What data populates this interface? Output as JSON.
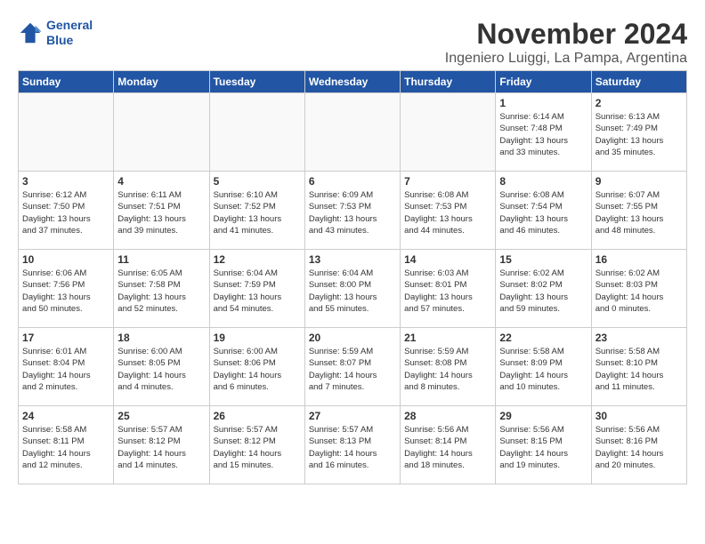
{
  "logo": {
    "line1": "General",
    "line2": "Blue"
  },
  "title": "November 2024",
  "subtitle": "Ingeniero Luiggi, La Pampa, Argentina",
  "headers": [
    "Sunday",
    "Monday",
    "Tuesday",
    "Wednesday",
    "Thursday",
    "Friday",
    "Saturday"
  ],
  "rows": [
    [
      {
        "day": "",
        "text": ""
      },
      {
        "day": "",
        "text": ""
      },
      {
        "day": "",
        "text": ""
      },
      {
        "day": "",
        "text": ""
      },
      {
        "day": "",
        "text": ""
      },
      {
        "day": "1",
        "text": "Sunrise: 6:14 AM\nSunset: 7:48 PM\nDaylight: 13 hours\nand 33 minutes."
      },
      {
        "day": "2",
        "text": "Sunrise: 6:13 AM\nSunset: 7:49 PM\nDaylight: 13 hours\nand 35 minutes."
      }
    ],
    [
      {
        "day": "3",
        "text": "Sunrise: 6:12 AM\nSunset: 7:50 PM\nDaylight: 13 hours\nand 37 minutes."
      },
      {
        "day": "4",
        "text": "Sunrise: 6:11 AM\nSunset: 7:51 PM\nDaylight: 13 hours\nand 39 minutes."
      },
      {
        "day": "5",
        "text": "Sunrise: 6:10 AM\nSunset: 7:52 PM\nDaylight: 13 hours\nand 41 minutes."
      },
      {
        "day": "6",
        "text": "Sunrise: 6:09 AM\nSunset: 7:53 PM\nDaylight: 13 hours\nand 43 minutes."
      },
      {
        "day": "7",
        "text": "Sunrise: 6:08 AM\nSunset: 7:53 PM\nDaylight: 13 hours\nand 44 minutes."
      },
      {
        "day": "8",
        "text": "Sunrise: 6:08 AM\nSunset: 7:54 PM\nDaylight: 13 hours\nand 46 minutes."
      },
      {
        "day": "9",
        "text": "Sunrise: 6:07 AM\nSunset: 7:55 PM\nDaylight: 13 hours\nand 48 minutes."
      }
    ],
    [
      {
        "day": "10",
        "text": "Sunrise: 6:06 AM\nSunset: 7:56 PM\nDaylight: 13 hours\nand 50 minutes."
      },
      {
        "day": "11",
        "text": "Sunrise: 6:05 AM\nSunset: 7:58 PM\nDaylight: 13 hours\nand 52 minutes."
      },
      {
        "day": "12",
        "text": "Sunrise: 6:04 AM\nSunset: 7:59 PM\nDaylight: 13 hours\nand 54 minutes."
      },
      {
        "day": "13",
        "text": "Sunrise: 6:04 AM\nSunset: 8:00 PM\nDaylight: 13 hours\nand 55 minutes."
      },
      {
        "day": "14",
        "text": "Sunrise: 6:03 AM\nSunset: 8:01 PM\nDaylight: 13 hours\nand 57 minutes."
      },
      {
        "day": "15",
        "text": "Sunrise: 6:02 AM\nSunset: 8:02 PM\nDaylight: 13 hours\nand 59 minutes."
      },
      {
        "day": "16",
        "text": "Sunrise: 6:02 AM\nSunset: 8:03 PM\nDaylight: 14 hours\nand 0 minutes."
      }
    ],
    [
      {
        "day": "17",
        "text": "Sunrise: 6:01 AM\nSunset: 8:04 PM\nDaylight: 14 hours\nand 2 minutes."
      },
      {
        "day": "18",
        "text": "Sunrise: 6:00 AM\nSunset: 8:05 PM\nDaylight: 14 hours\nand 4 minutes."
      },
      {
        "day": "19",
        "text": "Sunrise: 6:00 AM\nSunset: 8:06 PM\nDaylight: 14 hours\nand 6 minutes."
      },
      {
        "day": "20",
        "text": "Sunrise: 5:59 AM\nSunset: 8:07 PM\nDaylight: 14 hours\nand 7 minutes."
      },
      {
        "day": "21",
        "text": "Sunrise: 5:59 AM\nSunset: 8:08 PM\nDaylight: 14 hours\nand 8 minutes."
      },
      {
        "day": "22",
        "text": "Sunrise: 5:58 AM\nSunset: 8:09 PM\nDaylight: 14 hours\nand 10 minutes."
      },
      {
        "day": "23",
        "text": "Sunrise: 5:58 AM\nSunset: 8:10 PM\nDaylight: 14 hours\nand 11 minutes."
      }
    ],
    [
      {
        "day": "24",
        "text": "Sunrise: 5:58 AM\nSunset: 8:11 PM\nDaylight: 14 hours\nand 12 minutes."
      },
      {
        "day": "25",
        "text": "Sunrise: 5:57 AM\nSunset: 8:12 PM\nDaylight: 14 hours\nand 14 minutes."
      },
      {
        "day": "26",
        "text": "Sunrise: 5:57 AM\nSunset: 8:12 PM\nDaylight: 14 hours\nand 15 minutes."
      },
      {
        "day": "27",
        "text": "Sunrise: 5:57 AM\nSunset: 8:13 PM\nDaylight: 14 hours\nand 16 minutes."
      },
      {
        "day": "28",
        "text": "Sunrise: 5:56 AM\nSunset: 8:14 PM\nDaylight: 14 hours\nand 18 minutes."
      },
      {
        "day": "29",
        "text": "Sunrise: 5:56 AM\nSunset: 8:15 PM\nDaylight: 14 hours\nand 19 minutes."
      },
      {
        "day": "30",
        "text": "Sunrise: 5:56 AM\nSunset: 8:16 PM\nDaylight: 14 hours\nand 20 minutes."
      }
    ]
  ]
}
